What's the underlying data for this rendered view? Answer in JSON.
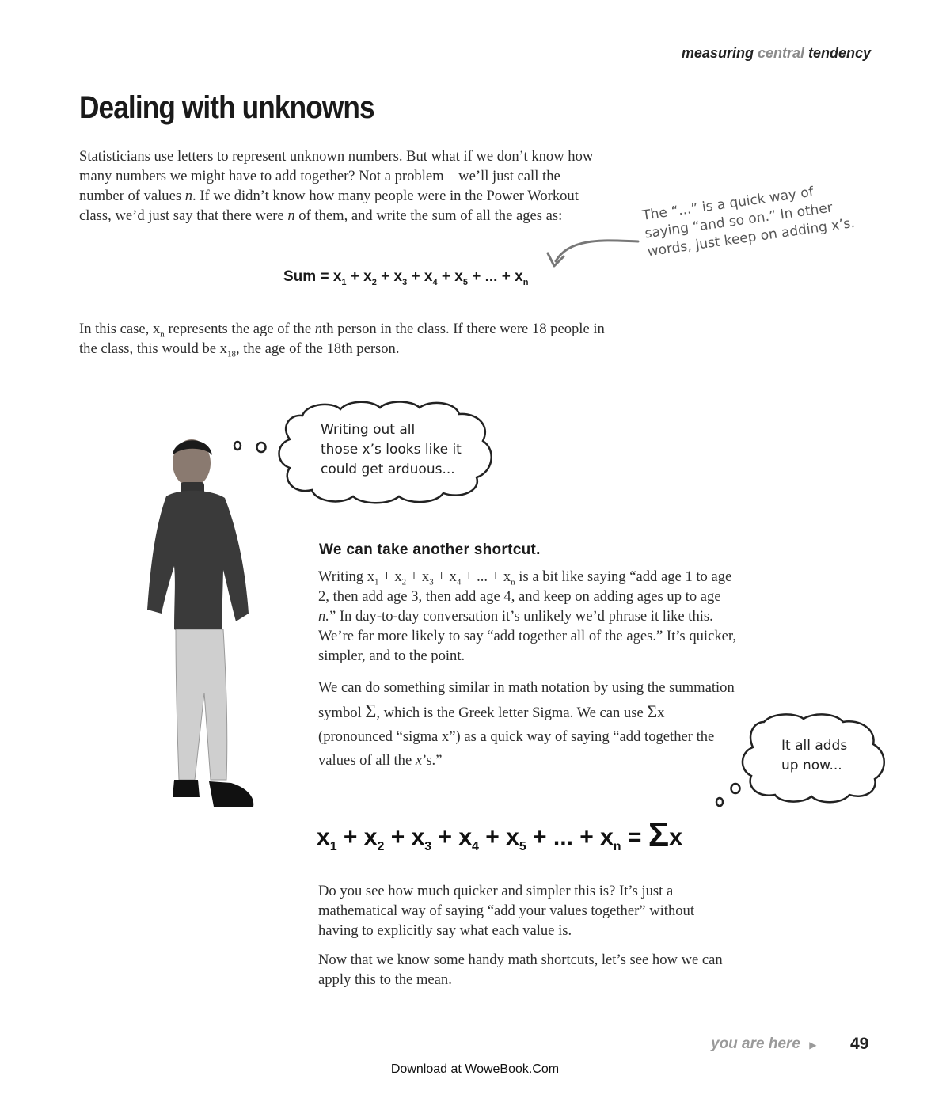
{
  "header": {
    "running_head_part1": "measuring ",
    "running_head_part2": "central",
    "running_head_part3": " tendency"
  },
  "title": "Dealing with unknowns",
  "intro": {
    "p1_a": "Statisticians use letters to represent unknown numbers. But what if we don’t know how many numbers we might have to add together? Not a problem—we’ll just call the number of values ",
    "p1_n": "n",
    "p1_b": ". If we didn’t know how many people were in the Power Workout class, we’d just say that there were ",
    "p1_n2": "n",
    "p1_c": " of them, and write the sum of all the ages as:"
  },
  "equation1": {
    "lead": "Sum = x",
    "s1": "1",
    "t2": " + x",
    "s2": "2",
    "t3": " + x",
    "s3": "3",
    "t4": " + x",
    "s4": "4",
    "t5": " + x",
    "s5": "5",
    "t6": " + ... + x",
    "sn": "n"
  },
  "annotation": {
    "text": "The “...” is a quick way of saying “and so on.” In other words, just keep on adding x’s."
  },
  "nth_para": {
    "a": "In this case, x",
    "sub_n": "n",
    "b": " represents the age of the ",
    "n_italic": "n",
    "c": "th person in the class. If there were 18 people in the class, this would be x",
    "sub_18": "18",
    "d": ", the age of the 18th person."
  },
  "thought1": {
    "line1": "Writing out all",
    "line2": "those x’s looks like it",
    "line3": "could get arduous..."
  },
  "shortcut": {
    "heading": "We can take another shortcut.",
    "p1_a": "Writing x",
    "p1_s1": "1",
    "p1_b": " + x",
    "p1_s2": "2",
    "p1_c": " + x",
    "p1_s3": "3",
    "p1_d": " + x",
    "p1_s4": "4",
    "p1_e": " + ... + x",
    "p1_sn": "n",
    "p1_f": " is a bit like saying “add age 1 to age 2, then add age 3, then add age 4, and keep on adding ages up to age ",
    "p1_n": "n.",
    "p1_g": "” In day-to-day conversation it’s unlikely we’d phrase it like this. We’re far more likely to say “add together all of the ages.” It’s quicker, simpler, and to the point.",
    "p2_a": "We can do something similar in math notation by using the summation symbol ",
    "p2_sigma": "Σ",
    "p2_b": ", which is the Greek letter Sigma. We can use ",
    "p2_sigma2": "Σ",
    "p2_c": "x (pronounced “sigma x”) as a quick way of saying “add together the values of all the ",
    "p2_x": "x",
    "p2_d": "’s.”"
  },
  "thought2": {
    "line1": "It all adds",
    "line2": "up now..."
  },
  "equation2": {
    "x1": "x",
    "s1": "1",
    "p2": " + x",
    "s2": "2",
    "p3": " + x",
    "s3": "3",
    "p4": " + x",
    "s4": "4",
    "p5": " + x",
    "s5": "5",
    "p6": " + ... + x",
    "sn": "n",
    "eq": " = ",
    "sigma": "Σ",
    "x_end": "x"
  },
  "closing": {
    "p1": "Do you see how much quicker and simpler this is? It’s just a mathematical way of saying “add your values together” without having to explicitly say what each value is.",
    "p2": "Now that we know some handy math shortcuts, let’s see how we can apply this to the mean."
  },
  "footer": {
    "you_are_here": "you are here",
    "page_number": "49",
    "download": "Download at WoweBook.Com"
  }
}
